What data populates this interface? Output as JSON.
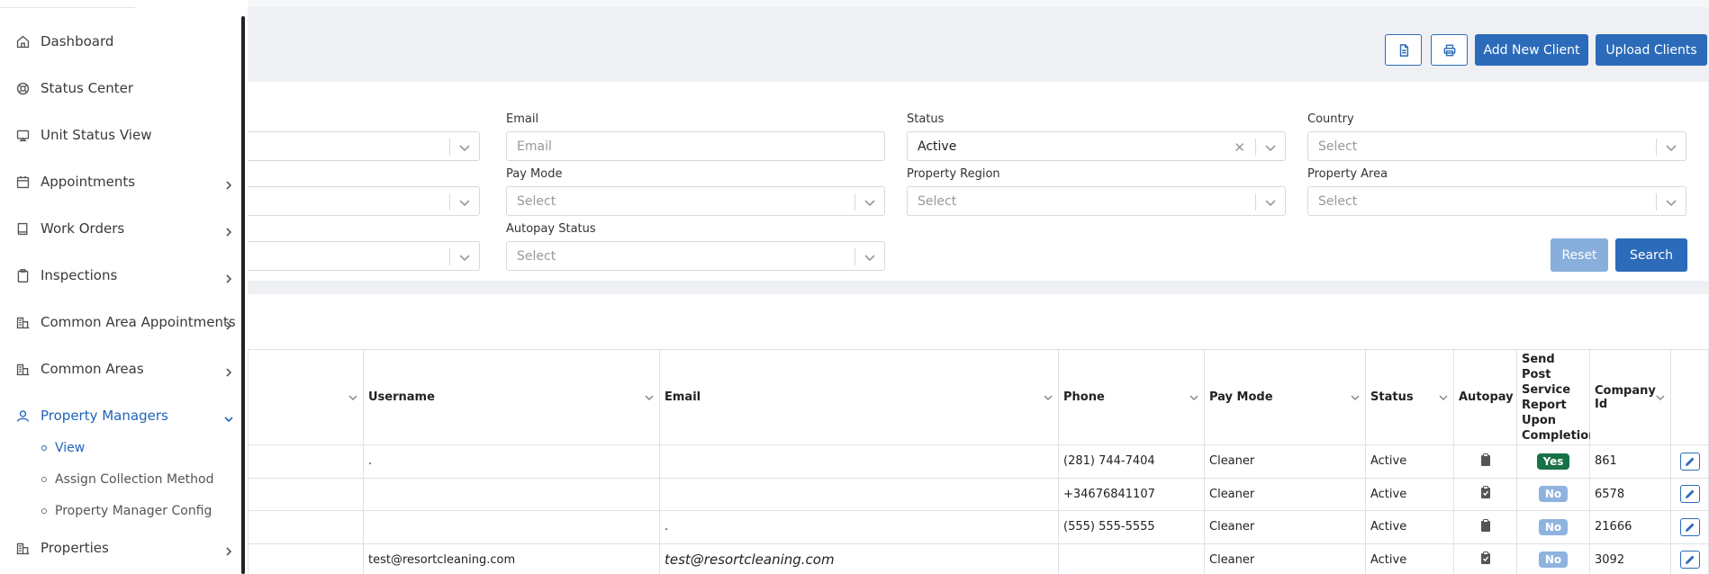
{
  "sidebar": {
    "items": [
      {
        "label": "Dashboard",
        "icon": "home-icon"
      },
      {
        "label": "Status Center",
        "icon": "lifebuoy-icon"
      },
      {
        "label": "Unit Status View",
        "icon": "monitor-icon"
      },
      {
        "label": "Appointments",
        "icon": "calendar-icon"
      },
      {
        "label": "Work Orders",
        "icon": "book-icon"
      },
      {
        "label": "Inspections",
        "icon": "clipboard-icon"
      },
      {
        "label": "Common Area Appointments",
        "icon": "building-icon"
      },
      {
        "label": "Common Areas",
        "icon": "building-icon"
      },
      {
        "label": "Property Managers",
        "icon": "user-icon"
      },
      {
        "label": "Properties",
        "icon": "building-icon"
      }
    ],
    "subitems": [
      {
        "label": "View"
      },
      {
        "label": "Assign Collection Method"
      },
      {
        "label": "Property Manager Config"
      }
    ]
  },
  "header": {
    "add_client_label": "Add New Client",
    "upload_clients_label": "Upload Clients"
  },
  "filters": {
    "email_label": "Email",
    "email_placeholder": "Email",
    "status_label": "Status",
    "status_value": "Active",
    "country_label": "Country",
    "country_value": "Select",
    "pay_mode_label": "Pay Mode",
    "pay_mode_value": "Select",
    "property_region_label": "Property Region",
    "property_region_value": "Select",
    "property_area_label": "Property Area",
    "property_area_value": "Select",
    "autopay_status_label": "Autopay Status",
    "autopay_status_value": "Select",
    "reset_label": "Reset",
    "search_label": "Search"
  },
  "table": {
    "headers": {
      "username": "Username",
      "email": "Email",
      "phone": "Phone",
      "pay_mode": "Pay Mode",
      "status": "Status",
      "autopay": "Autopay",
      "send_post": "Send Post Service Report Upon Completion",
      "company_id": "Company Id"
    },
    "rows": [
      {
        "username": ".",
        "email": "",
        "phone": "(281) 744-7404",
        "pay_mode": "Cleaner",
        "status": "Active",
        "send_post": "Yes",
        "company_id": "861"
      },
      {
        "username": "",
        "email": "",
        "phone": "+34676841107",
        "pay_mode": "Cleaner",
        "status": "Active",
        "send_post": "No",
        "company_id": "6578"
      },
      {
        "username": "",
        "email": ".",
        "phone": "(555) 555-5555",
        "pay_mode": "Cleaner",
        "status": "Active",
        "send_post": "No",
        "company_id": "21666"
      },
      {
        "username": "test@resortcleaning.com",
        "email": "test@resortcleaning.com",
        "phone": "",
        "pay_mode": "Cleaner",
        "status": "Active",
        "send_post": "No",
        "company_id": "3092"
      }
    ]
  },
  "colors": {
    "primary": "#2c6bb9",
    "yes_badge": "#177245",
    "no_badge": "#8fb3df"
  }
}
